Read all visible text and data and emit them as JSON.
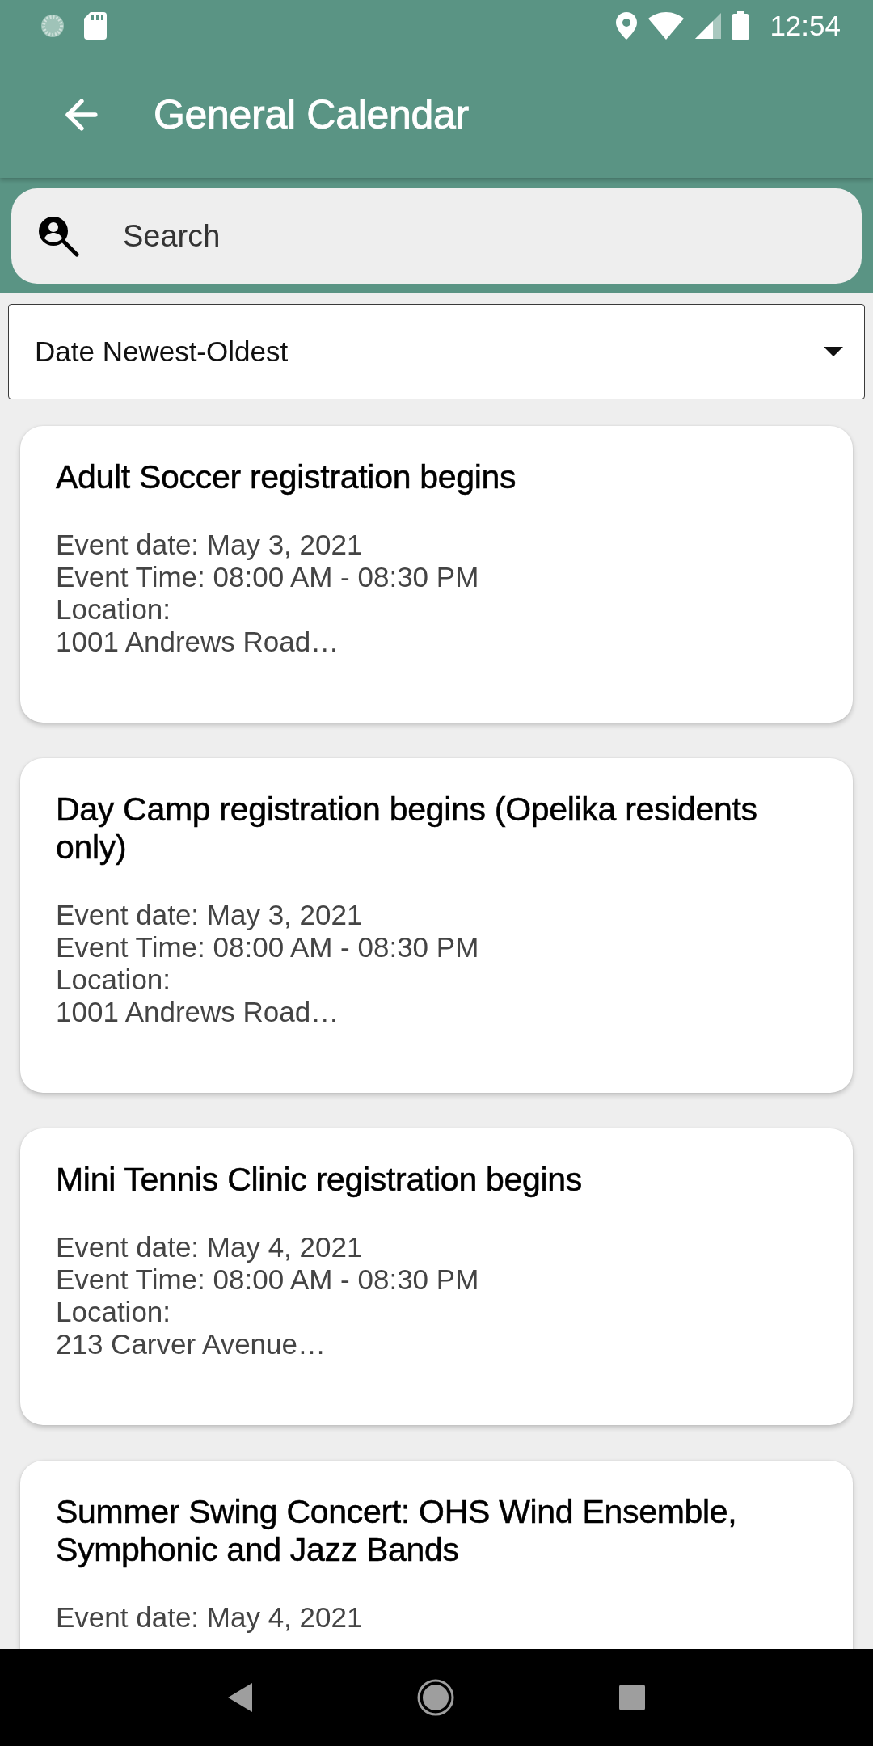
{
  "status_bar": {
    "time": "12:54"
  },
  "app_bar": {
    "title": "General Calendar"
  },
  "search": {
    "placeholder": "Search"
  },
  "sort_dropdown": {
    "value": "Date Newest-Oldest"
  },
  "events": [
    {
      "title": "Adult Soccer registration begins",
      "date": "Event date: May 3, 2021",
      "time": "Event Time: 08:00 AM - 08:30 PM",
      "location_label": "Location:",
      "location": "1001 Andrews Road…"
    },
    {
      "title": "Day Camp registration begins (Opelika residents only)",
      "date": "Event date: May 3, 2021",
      "time": "Event Time: 08:00 AM - 08:30 PM",
      "location_label": "Location:",
      "location": "1001 Andrews Road…"
    },
    {
      "title": "Mini Tennis Clinic registration begins",
      "date": "Event date: May 4, 2021",
      "time": "Event Time: 08:00 AM - 08:30 PM",
      "location_label": "Location:",
      "location": "213 Carver Avenue…"
    },
    {
      "title": "Summer Swing Concert: OHS Wind Ensemble, Symphonic and Jazz Bands",
      "date": "Event date: May 4, 2021"
    }
  ]
}
